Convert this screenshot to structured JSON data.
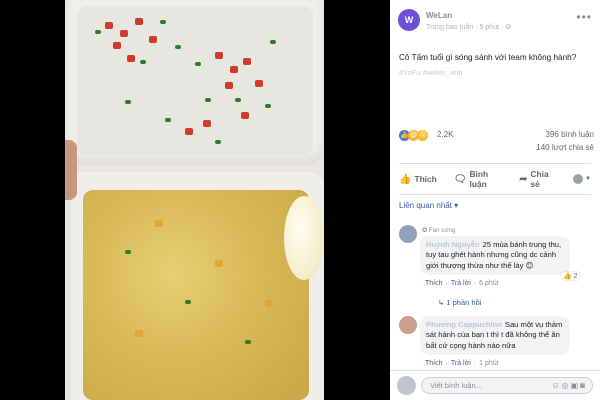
{
  "post": {
    "page_name": "WeLan",
    "meta": "Trong bao tuần · 5 phút · ⚙",
    "caption": "Cô Tấm tuổi gì sóng sánh với team không hành?",
    "tags": "#YoFu #welas_anh",
    "more_icon": "ellipsis-icon"
  },
  "stats": {
    "reactions_count": "2,2K",
    "comments": "396 bình luận",
    "shares": "140 lượt chia sẻ",
    "reaction_colors": [
      "#4a76e8",
      "#f7b928",
      "#f7b928"
    ]
  },
  "actions": {
    "like": "Thích",
    "comment": "Bình luận",
    "share": "Chia sẻ"
  },
  "related": "Liên quan nhất ▾",
  "comments": [
    {
      "badge": "Fan cứng",
      "author": "Huỳnh Nguyễn",
      "text": "25 mùa bánh trung thu, tuy tau ghét hành nhưng cũng dc cảnh giới thượng thừa như thế lày 😊",
      "like": "Thích",
      "reply": "Trả lời",
      "time": "6 phút",
      "reactions": "2",
      "replies": "1 phản hồi"
    },
    {
      "author": "Phương Cappuchino",
      "text": "Sau một vụ thảm sát hành của bạn t thì t đã không thể ăn bất cứ cọng hành nào nữa",
      "like": "Thích",
      "reply": "Trả lời",
      "time": "1 phút"
    }
  ],
  "write": {
    "placeholder": "Viết bình luận..."
  }
}
